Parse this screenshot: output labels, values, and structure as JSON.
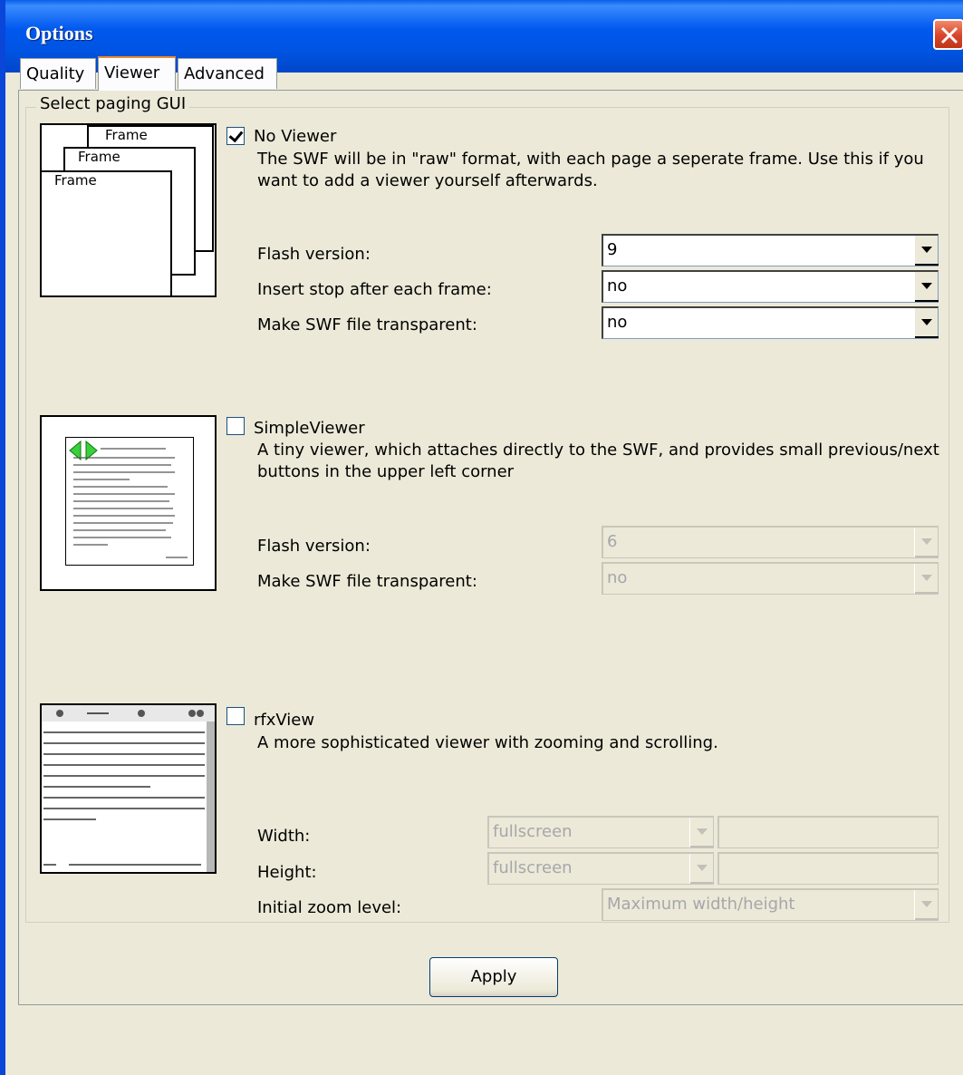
{
  "window": {
    "title": "Options"
  },
  "tabs": [
    {
      "label": "Quality"
    },
    {
      "label": "Viewer"
    },
    {
      "label": "Advanced"
    }
  ],
  "group": {
    "label": "Select paging GUI"
  },
  "options": {
    "no_viewer": {
      "title": "No Viewer",
      "checked": true,
      "description": "The SWF will be in \"raw\" format, with each page a seperate frame. Use this if you want to add a viewer yourself afterwards.",
      "thumb_frames": [
        "Frame",
        "Frame",
        "Frame"
      ],
      "fields": [
        {
          "label": "Flash version:",
          "value": "9"
        },
        {
          "label": "Insert stop after each frame:",
          "value": "no"
        },
        {
          "label": "Make SWF file transparent:",
          "value": "no"
        }
      ]
    },
    "simple_viewer": {
      "title": "SimpleViewer",
      "checked": false,
      "description": "A tiny viewer, which attaches directly to the SWF, and provides small previous/next buttons in the upper left corner",
      "fields": [
        {
          "label": "Flash version:",
          "value": "6"
        },
        {
          "label": "Make SWF file transparent:",
          "value": "no"
        }
      ]
    },
    "rfx_view": {
      "title": "rfxView",
      "checked": false,
      "description": "A more sophisticated viewer with zooming and scrolling.",
      "fields": [
        {
          "label": "Width:",
          "value": "fullscreen",
          "extra": ""
        },
        {
          "label": "Height:",
          "value": "fullscreen",
          "extra": ""
        },
        {
          "label": "Initial zoom level:",
          "value": "Maximum width/height"
        }
      ]
    }
  },
  "footer": {
    "apply_label": "Apply"
  }
}
